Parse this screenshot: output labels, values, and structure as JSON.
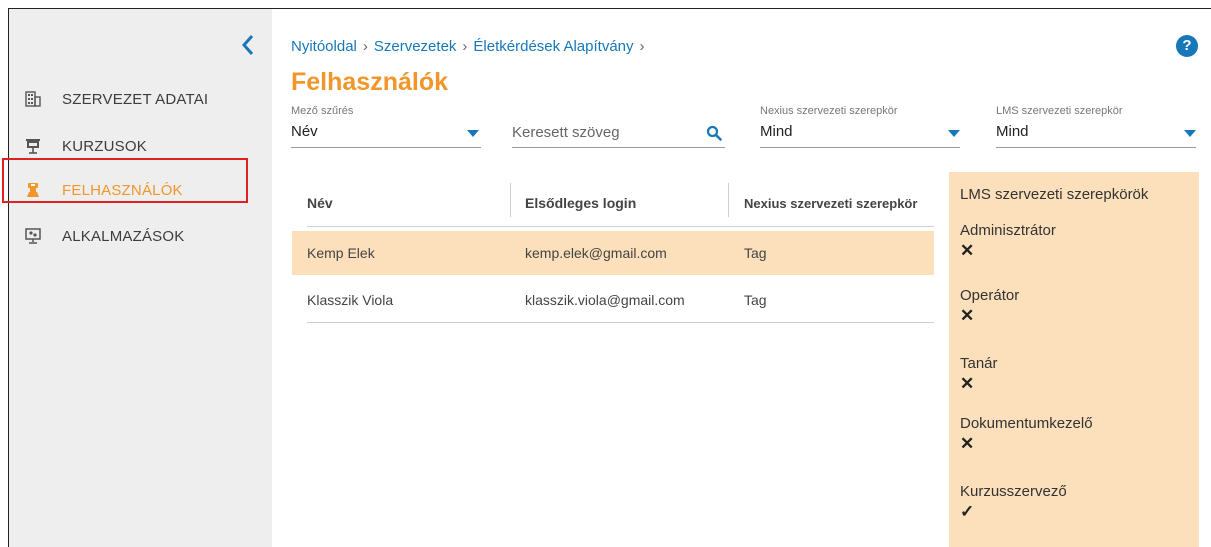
{
  "sidebar": {
    "items": [
      {
        "label": "SZERVEZET ADATAI",
        "icon": "building-icon",
        "active": false
      },
      {
        "label": "KURZUSOK",
        "icon": "presentation-icon",
        "active": false
      },
      {
        "label": "FELHASZNÁLÓK",
        "icon": "user-icon",
        "active": true
      },
      {
        "label": "ALKALMAZÁSOK",
        "icon": "monitor-apps-icon",
        "active": false
      }
    ]
  },
  "breadcrumb": {
    "items": [
      "Nyitóoldal",
      "Szervezetek",
      "Életkérdések Alapítvány"
    ]
  },
  "page": {
    "title": "Felhasználók"
  },
  "help": {
    "label": "?"
  },
  "filters": {
    "field": {
      "label": "Mező szűrés",
      "value": "Név"
    },
    "search": {
      "placeholder": "Keresett szöveg"
    },
    "nexius_role": {
      "label": "Nexius szervezeti szerepkör",
      "value": "Mind"
    },
    "lms_role": {
      "label": "LMS szervezeti szerepkör",
      "value": "Mind"
    }
  },
  "table": {
    "headers": [
      "Név",
      "Elsődleges login",
      "Nexius szervezeti szerepkör"
    ],
    "rows": [
      {
        "name": "Kemp Elek",
        "login": "kemp.elek@gmail.com",
        "role": "Tag",
        "selected": true
      },
      {
        "name": "Klasszik Viola",
        "login": "klasszik.viola@gmail.com",
        "role": "Tag",
        "selected": false
      }
    ]
  },
  "lms_panel": {
    "title": "LMS szervezeti szerepkörök",
    "roles": [
      {
        "name": "Adminisztrátor",
        "mark": "✕"
      },
      {
        "name": "Operátor",
        "mark": "✕"
      },
      {
        "name": "Tanár",
        "mark": "✕"
      },
      {
        "name": "Dokumentumkezelő",
        "mark": "✕"
      },
      {
        "name": "Kurzusszervező",
        "mark": "✓"
      }
    ]
  },
  "colors": {
    "accent": "#f0962a",
    "link": "#1877b8",
    "selected_row": "#fce0bb",
    "highlight_box": "#e02020"
  }
}
